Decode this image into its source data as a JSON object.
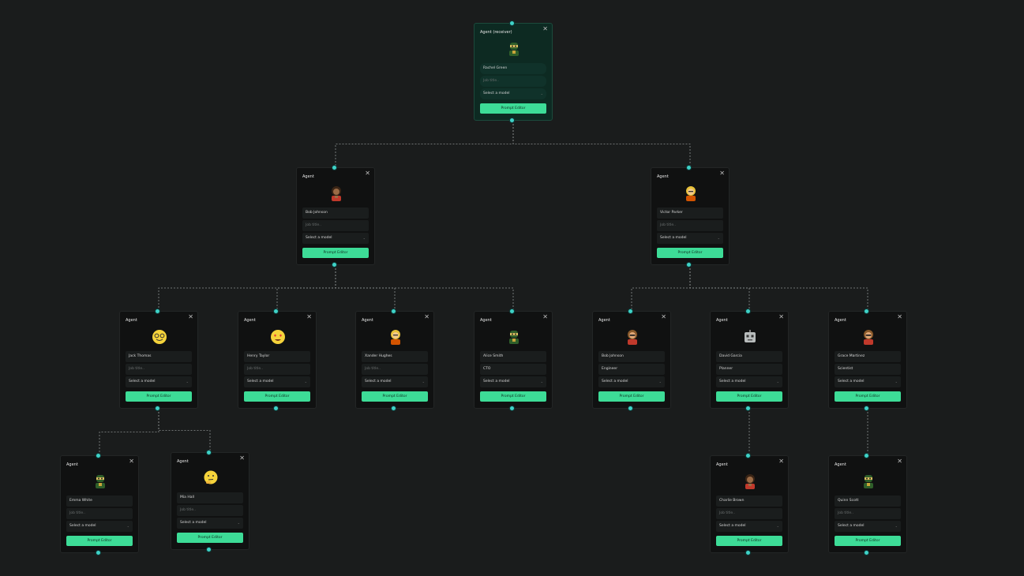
{
  "theme": {
    "background": "#1a1c1c",
    "node_background": "#101111",
    "receiver_background": "#0d2a22",
    "accent": "#3ddc97",
    "handle": "#3fd2c7",
    "edge": "#8a8f8f"
  },
  "labels": {
    "receiver_title": "Agent (receiver)",
    "agent_title": "Agent",
    "job_placeholder": "Job title..",
    "model_placeholder": "Select a model",
    "prompt_editor": "Prompt Editor",
    "close_glyph": "✕",
    "chevron_glyph": "⌄"
  },
  "nodes": [
    {
      "id": "n0",
      "title": "Agent (receiver)",
      "receiver": true,
      "name": "Rachel Green",
      "job": "",
      "model": "Select a model",
      "avatar": "ninja-icon"
    },
    {
      "id": "n1",
      "title": "Agent",
      "receiver": false,
      "name": "Bob Johnson",
      "job": "",
      "model": "Select a model",
      "avatar": "woman-dark-icon"
    },
    {
      "id": "n2",
      "title": "Agent",
      "receiver": false,
      "name": "Victor Parker",
      "job": "",
      "model": "Select a model",
      "avatar": "woman-blonde-icon"
    },
    {
      "id": "n3",
      "title": "Agent",
      "receiver": false,
      "name": "Jack Thomas",
      "job": "",
      "model": "Select a model",
      "avatar": "nerd-face-icon"
    },
    {
      "id": "n4",
      "title": "Agent",
      "receiver": false,
      "name": "Henry Taylor",
      "job": "",
      "model": "Select a model",
      "avatar": "heart-eyes-icon"
    },
    {
      "id": "n5",
      "title": "Agent",
      "receiver": false,
      "name": "Xander Hughes",
      "job": "",
      "model": "Select a model",
      "avatar": "woman-blonde-icon"
    },
    {
      "id": "n6",
      "title": "Agent",
      "receiver": false,
      "name": "Alice Smith",
      "job": "CTO",
      "model": "Select a model",
      "avatar": "ninja-icon"
    },
    {
      "id": "n7",
      "title": "Agent",
      "receiver": false,
      "name": "Bob Johnson",
      "job": "Engineer",
      "model": "Select a model",
      "avatar": "woman-sunglasses-icon"
    },
    {
      "id": "n8",
      "title": "Agent",
      "receiver": false,
      "name": "David Garcia",
      "job": "Planner",
      "model": "Select a model",
      "avatar": "robot-icon"
    },
    {
      "id": "n9",
      "title": "Agent",
      "receiver": false,
      "name": "Grace Martinez",
      "job": "Scientist",
      "model": "Select a model",
      "avatar": "woman-sunglasses-icon"
    },
    {
      "id": "n10",
      "title": "Agent",
      "receiver": false,
      "name": "Emma White",
      "job": "",
      "model": "Select a model",
      "avatar": "ninja-icon"
    },
    {
      "id": "n11",
      "title": "Agent",
      "receiver": false,
      "name": "Mia Hall",
      "job": "",
      "model": "Select a model",
      "avatar": "thinking-face-icon"
    },
    {
      "id": "n12",
      "title": "Agent",
      "receiver": false,
      "name": "Charlie Brown",
      "job": "",
      "model": "Select a model",
      "avatar": "woman-dark-icon"
    },
    {
      "id": "n13",
      "title": "Agent",
      "receiver": false,
      "name": "Quinn Scott",
      "job": "",
      "model": "Select a model",
      "avatar": "ninja-icon"
    }
  ],
  "edges": [
    [
      "n0",
      "n1"
    ],
    [
      "n0",
      "n2"
    ],
    [
      "n1",
      "n3"
    ],
    [
      "n1",
      "n4"
    ],
    [
      "n1",
      "n5"
    ],
    [
      "n1",
      "n6"
    ],
    [
      "n2",
      "n7"
    ],
    [
      "n2",
      "n8"
    ],
    [
      "n2",
      "n9"
    ],
    [
      "n3",
      "n10"
    ],
    [
      "n3",
      "n11"
    ],
    [
      "n8",
      "n12"
    ],
    [
      "n9",
      "n13"
    ]
  ]
}
